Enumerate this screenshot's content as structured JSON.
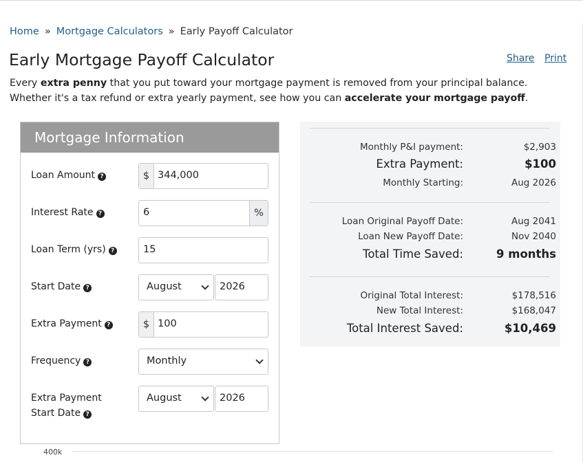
{
  "breadcrumb": {
    "home": "Home",
    "separator": "»",
    "mortgage_calculators": "Mortgage Calculators",
    "current": "Early Payoff Calculator"
  },
  "header": {
    "title": "Early Mortgage Payoff Calculator",
    "share": "Share",
    "print": "Print"
  },
  "intro": {
    "part1": "Every ",
    "bold1": "extra penny",
    "part2": " that you put toward your mortgage payment is removed from your principal balance. Whether it's a tax refund or extra yearly payment, see how you can ",
    "bold2": "accelerate your mortgage payoff",
    "part3": "."
  },
  "form": {
    "title": "Mortgage Information",
    "help_glyph": "?",
    "loan_amount": {
      "label": "Loan Amount",
      "prefix": "$",
      "value": "344,000"
    },
    "interest_rate": {
      "label": "Interest Rate",
      "suffix": "%",
      "value": "6"
    },
    "loan_term": {
      "label": "Loan Term (yrs)",
      "value": "15"
    },
    "start_date": {
      "label": "Start Date",
      "month": "August",
      "year": "2026"
    },
    "extra_payment": {
      "label": "Extra Payment",
      "prefix": "$",
      "value": "100"
    },
    "frequency": {
      "label": "Frequency",
      "value": "Monthly"
    },
    "extra_start": {
      "label_line1": "Extra Payment",
      "label_line2": "Start Date",
      "month": "August",
      "year": "2026"
    }
  },
  "results": {
    "monthly_pi_label": "Monthly P&I payment:",
    "monthly_pi_value": "$2,903",
    "extra_payment_label": "Extra Payment:",
    "extra_payment_value": "$100",
    "monthly_starting_label": "Monthly Starting:",
    "monthly_starting_value": "Aug 2026",
    "original_payoff_label": "Loan Original Payoff Date:",
    "original_payoff_value": "Aug 2041",
    "new_payoff_label": "Loan New Payoff Date:",
    "new_payoff_value": "Nov 2040",
    "time_saved_label": "Total Time Saved:",
    "time_saved_value": "9 months",
    "original_interest_label": "Original Total Interest:",
    "original_interest_value": "$178,516",
    "new_interest_label": "New Total Interest:",
    "new_interest_value": "$168,047",
    "interest_saved_label": "Total Interest Saved:",
    "interest_saved_value": "$10,469"
  },
  "chart": {
    "y_tick_top": "400k"
  }
}
